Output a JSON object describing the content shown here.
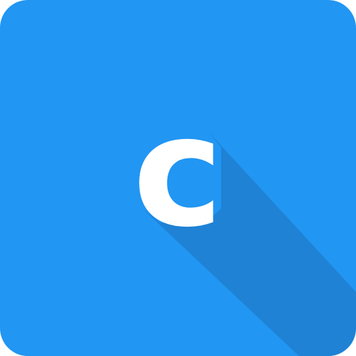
{
  "icon": {
    "letter": "c",
    "name": "letter-c-icon"
  },
  "colors": {
    "tile": "#2196F3",
    "shadow": "#1E7FCE",
    "glyph": "#FFFFFF"
  }
}
